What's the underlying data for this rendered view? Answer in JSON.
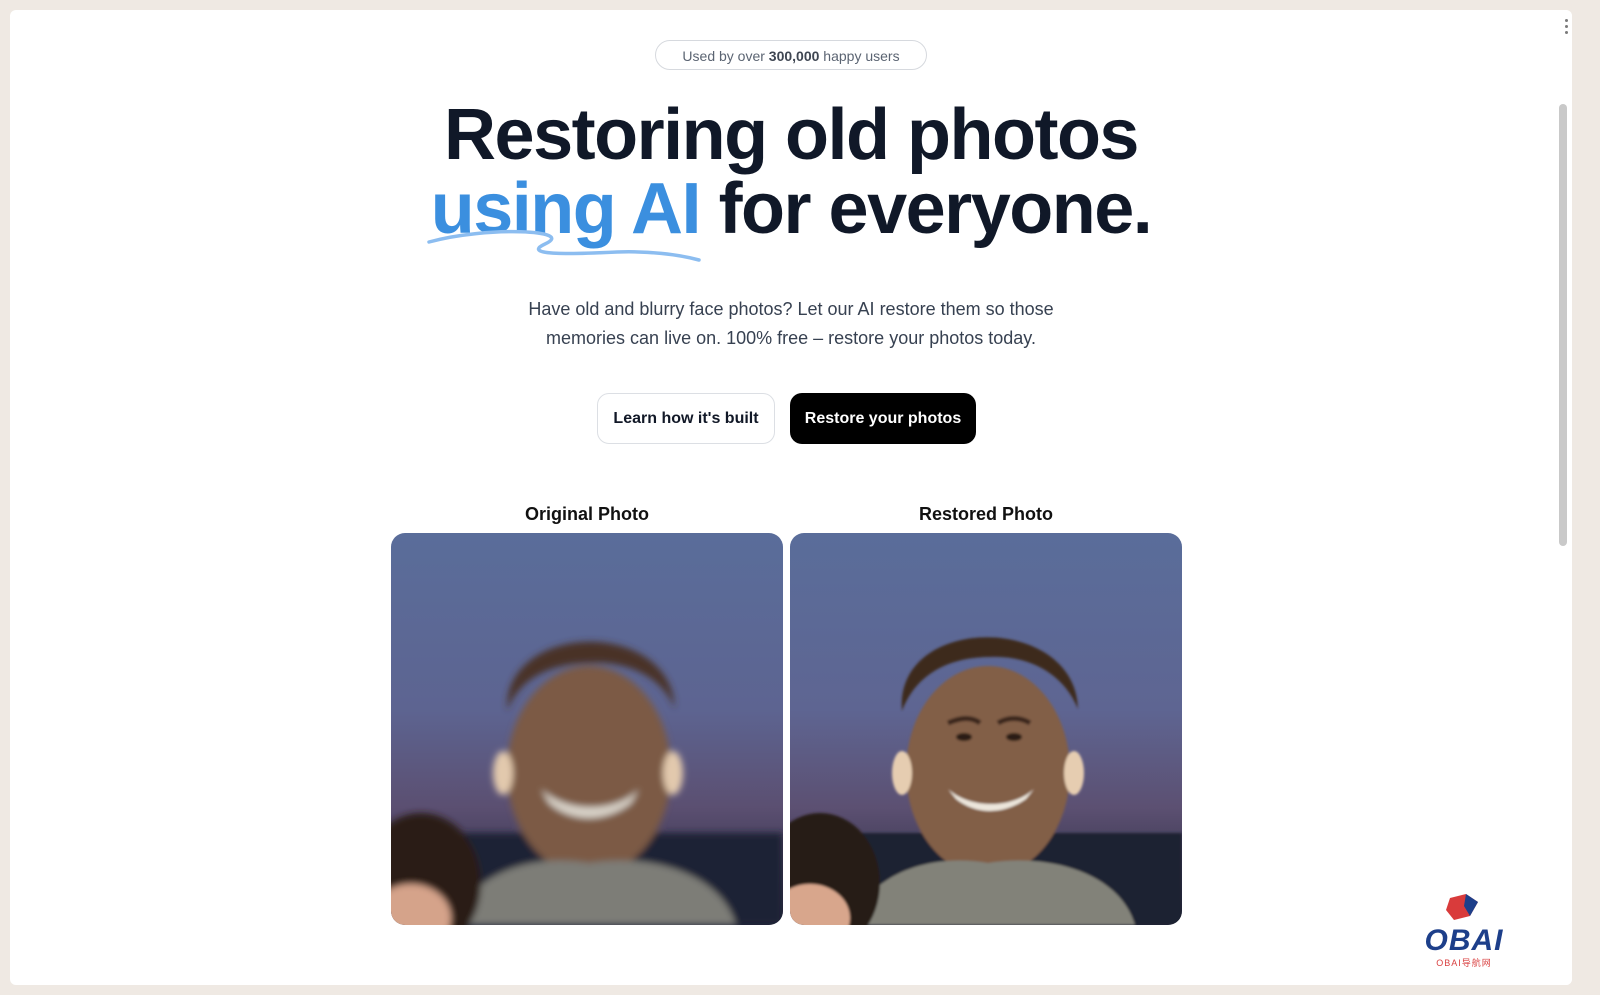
{
  "badge": {
    "prefix": "Used by over ",
    "count": "300,000",
    "suffix": " happy users"
  },
  "hero": {
    "line1": "Restoring old photos",
    "accent": "using AI",
    "line2_rest": " for everyone.",
    "subtitle": "Have old and blurry face photos? Let our AI restore them so those memories can live on. 100% free – restore your photos today.",
    "accent_color": "#3b8fdf"
  },
  "buttons": {
    "learn": "Learn how it's built",
    "restore": "Restore your photos"
  },
  "comparison": {
    "original_label": "Original Photo",
    "restored_label": "Restored Photo"
  },
  "watermark": {
    "brand": "OBAI",
    "tagline": "OBAI导航网"
  }
}
